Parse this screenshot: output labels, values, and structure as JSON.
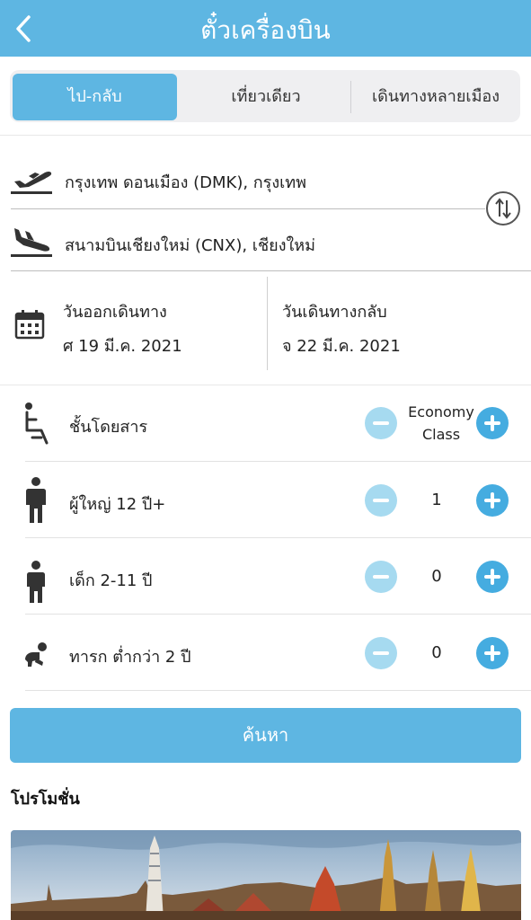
{
  "header": {
    "title": "ตั๋วเครื่องบิน",
    "back_icon": "chevron-left-icon"
  },
  "trip_tabs": [
    {
      "label": "ไป-กลับ",
      "active": true
    },
    {
      "label": "เที่ยวเดียว",
      "active": false
    },
    {
      "label": "เดินทางหลายเมือง",
      "active": false
    }
  ],
  "route": {
    "origin": "กรุงเทพ ดอนเมือง (DMK), กรุงเทพ",
    "destination": "สนามบินเชียงใหม่ (CNX), เชียงใหม่",
    "origin_icon": "plane-takeoff-icon",
    "destination_icon": "plane-landing-icon",
    "swap_icon": "swap-vertical-icon"
  },
  "dates": {
    "depart_label": "วันออกเดินทาง",
    "depart_value": "ศ 19 มี.ค. 2021",
    "return_label": "วันเดินทางกลับ",
    "return_value": "จ 22 มี.ค. 2021",
    "icon": "calendar-icon"
  },
  "passengers": {
    "cabin": {
      "label": "ชั้นโดยสาร",
      "value_line1": "Economy",
      "value_line2": "Class",
      "icon": "seat-icon"
    },
    "adult": {
      "label": "ผู้ใหญ่ 12 ปี+",
      "count": "1",
      "icon": "adult-icon"
    },
    "child": {
      "label": "เด็ก 2-11 ปี",
      "count": "0",
      "icon": "child-icon"
    },
    "infant": {
      "label": "ทารก ต่ำกว่า 2 ปี",
      "count": "0",
      "icon": "infant-icon"
    }
  },
  "search_button": "ค้นหา",
  "promotion": {
    "title": "โปรโมชั่น"
  },
  "colors": {
    "primary": "#5eb6e2",
    "minus_button": "#a6daf0",
    "plus_button": "#45ace0"
  }
}
